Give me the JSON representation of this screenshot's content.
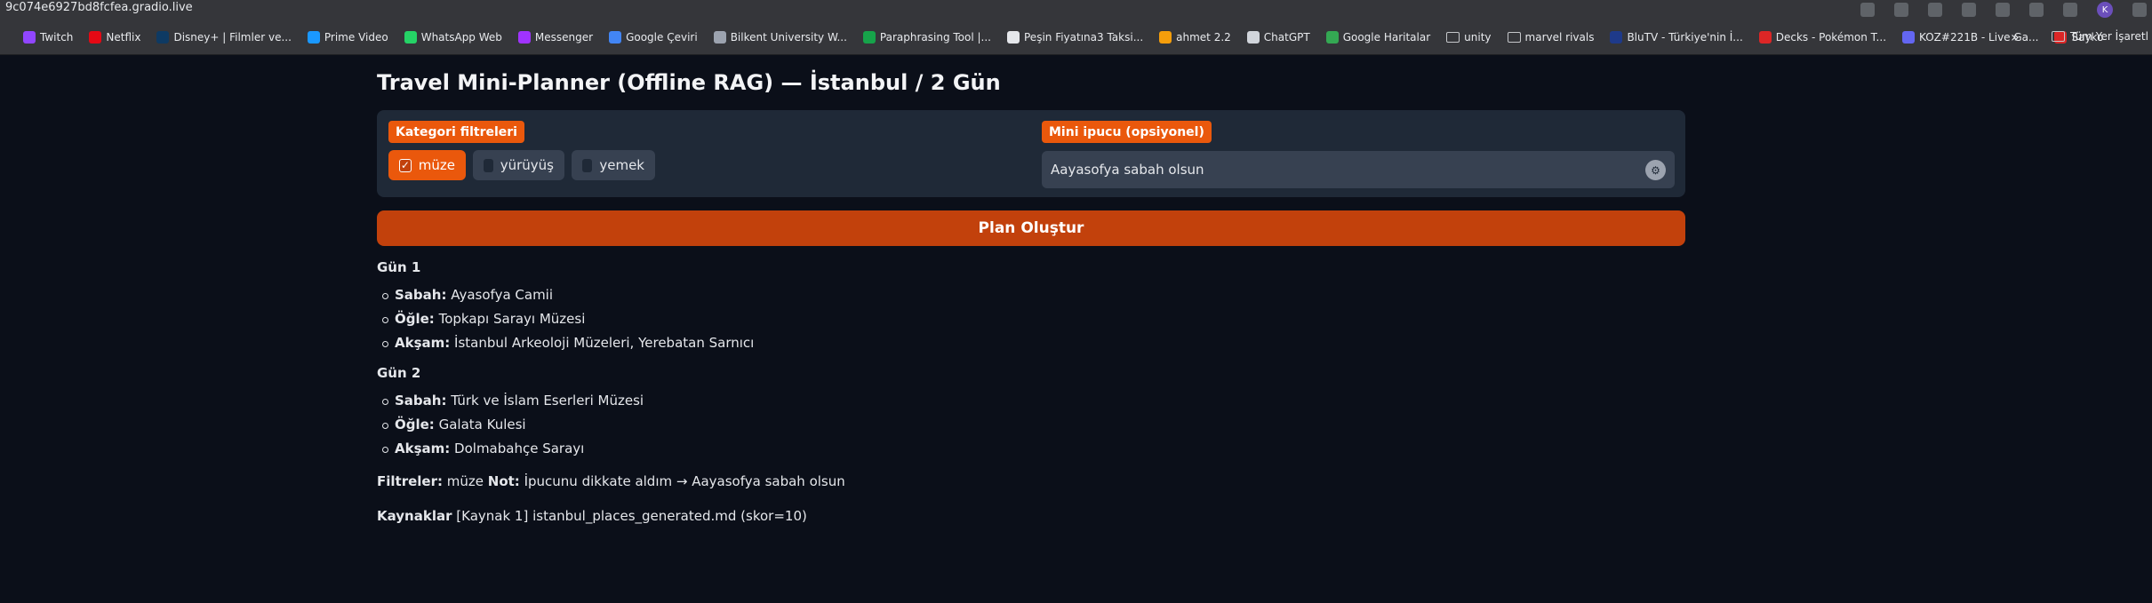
{
  "browser": {
    "url": "9c074e6927bd8fcfea.gradio.live",
    "profile_initial": "K",
    "bookmarks": [
      {
        "label": "Twitch",
        "color": "#9146ff"
      },
      {
        "label": "Netflix",
        "color": "#e50914"
      },
      {
        "label": "Disney+ | Filmler ve...",
        "color": "#0e3a63"
      },
      {
        "label": "Prime Video",
        "color": "#1a98ff"
      },
      {
        "label": "WhatsApp Web",
        "color": "#25d366"
      },
      {
        "label": "Messenger",
        "color": "#a033ff"
      },
      {
        "label": "Google Çeviri",
        "color": "#4285f4"
      },
      {
        "label": "Bilkent University W...",
        "color": "#9ca3af"
      },
      {
        "label": "Paraphrasing Tool |...",
        "color": "#16a34a"
      },
      {
        "label": "Peşin Fiyatına3 Taksi...",
        "color": "#e5e7eb"
      },
      {
        "label": "ahmet 2.2",
        "color": "#f59e0b"
      },
      {
        "label": "ChatGPT",
        "color": "#d1d5db"
      },
      {
        "label": "Google Haritalar",
        "color": "#34a853"
      },
      {
        "label": "unity",
        "folder": true
      },
      {
        "label": "marvel rivals",
        "folder": true
      },
      {
        "label": "BluTV - Türkiye'nin İ...",
        "color": "#1e3a8a"
      },
      {
        "label": "Decks - Pokémon T...",
        "color": "#dc2626"
      },
      {
        "label": "KOZ#221B - Live Ga...",
        "color": "#6366f1"
      },
      {
        "label": "Sayko",
        "color": "#dc2626"
      }
    ],
    "overflow": "»",
    "all_bookmarks": "Tüm Yer İşaretl"
  },
  "app": {
    "title": "Travel Mini-Planner (Offline RAG) — İstanbul / 2 Gün",
    "filters_label": "Kategori filtreleri",
    "filters": [
      {
        "label": "müze",
        "checked": true
      },
      {
        "label": "yürüyüş",
        "checked": false
      },
      {
        "label": "yemek",
        "checked": false
      }
    ],
    "hint_label": "Mini ipucu (opsiyonel)",
    "hint_value": "Aayasofya sabah olsun",
    "plan_button": "Plan Oluştur",
    "days": [
      {
        "title": "Gün 1",
        "items": [
          {
            "slot": "Sabah:",
            "text": "Ayasofya Camii"
          },
          {
            "slot": "Öğle:",
            "text": "Topkapı Sarayı Müzesi"
          },
          {
            "slot": "Akşam:",
            "text": "İstanbul Arkeoloji Müzeleri, Yerebatan Sarnıcı"
          }
        ]
      },
      {
        "title": "Gün 2",
        "items": [
          {
            "slot": "Sabah:",
            "text": "Türk ve İslam Eserleri Müzesi"
          },
          {
            "slot": "Öğle:",
            "text": "Galata Kulesi"
          },
          {
            "slot": "Akşam:",
            "text": "Dolmabahçe Sarayı"
          }
        ]
      }
    ],
    "filters_line": {
      "label": "Filtreler:",
      "value": "müze",
      "note_label": "Not:",
      "note": "İpucunu dikkate aldım → Aayasofya sabah olsun"
    },
    "sources_line": {
      "label": "Kaynaklar",
      "value": "[Kaynak 1] istanbul_places_generated.md (skor=10)"
    }
  }
}
